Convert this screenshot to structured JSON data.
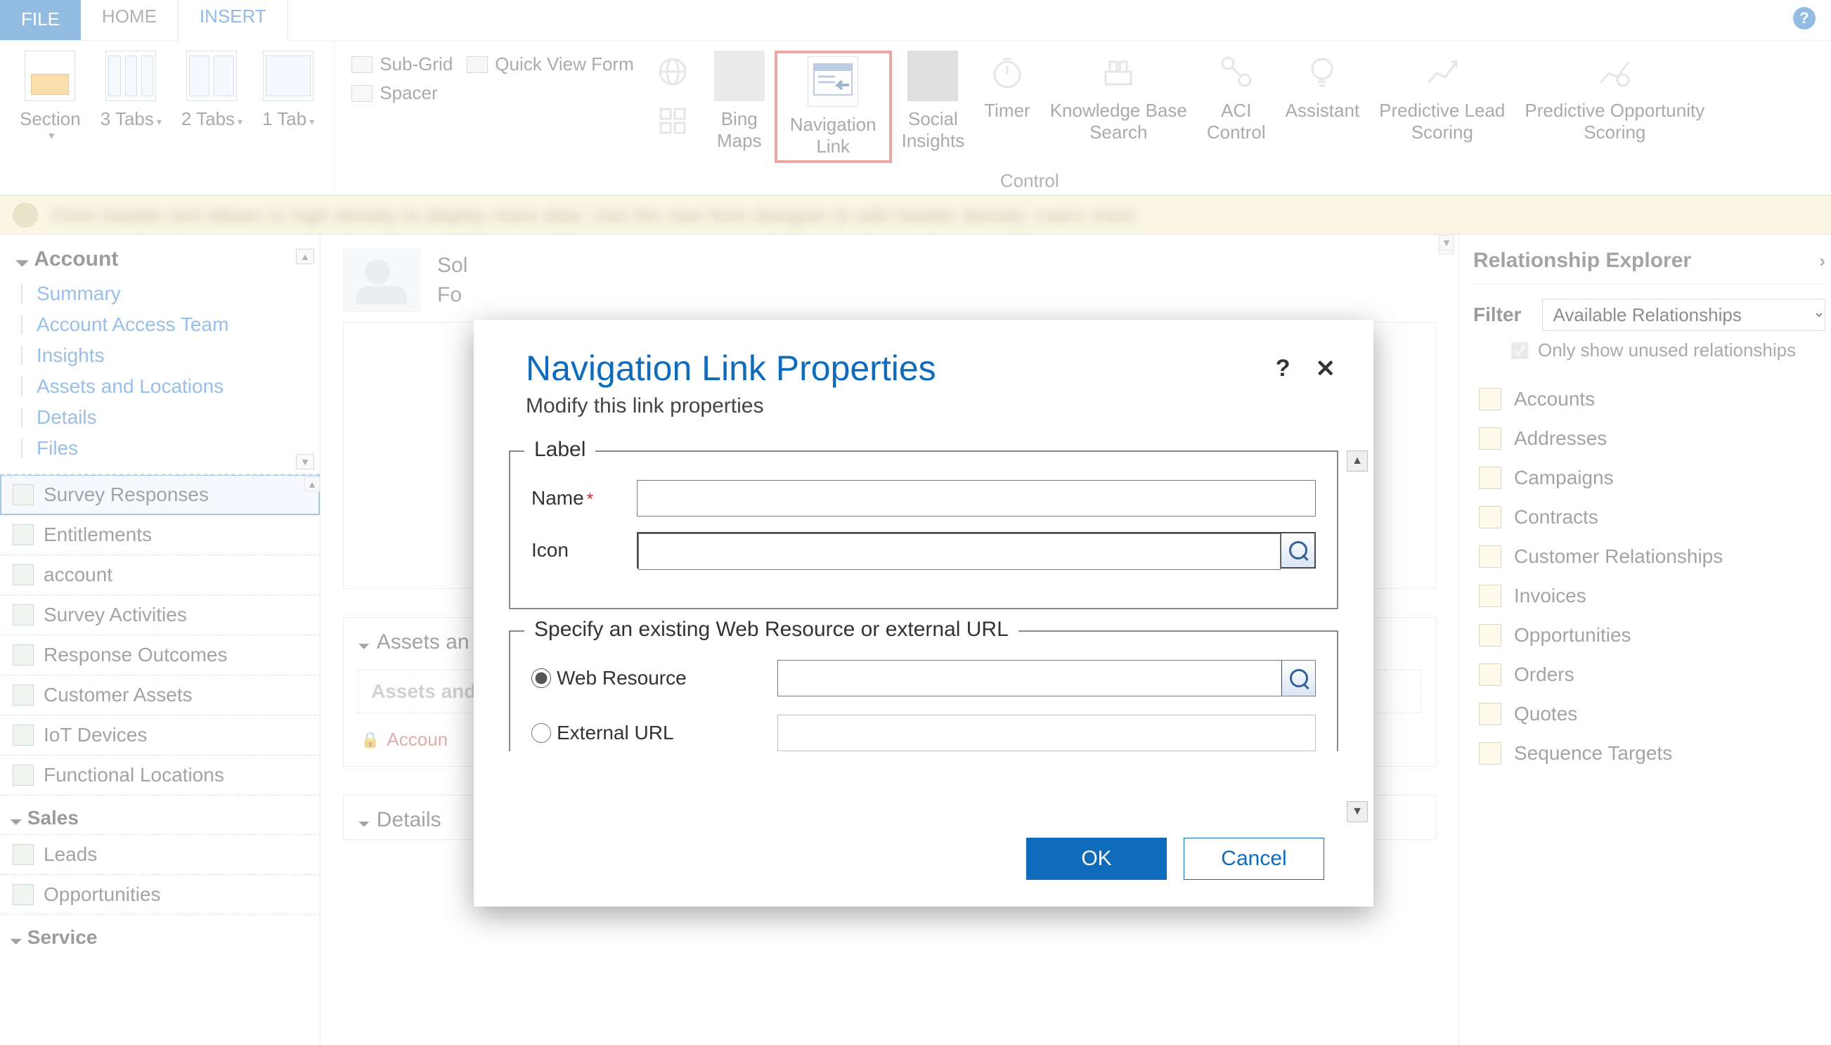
{
  "tabs": {
    "file": "FILE",
    "home": "HOME",
    "insert": "INSERT"
  },
  "ribbon": {
    "section": "Section",
    "tabs3": "3\nTabs",
    "tabs2": "2\nTabs",
    "tab1": "1\nTab",
    "subgrid": "Sub-Grid",
    "spacer": "Spacer",
    "quickview": "Quick View Form",
    "bing": "Bing\nMaps",
    "navlink": "Navigation\nLink",
    "social": "Social\nInsights",
    "timer": "Timer",
    "kb": "Knowledge Base\nSearch",
    "aci": "ACI\nControl",
    "assistant": "Assistant",
    "plead": "Predictive Lead\nScoring",
    "popp": "Predictive Opportunity\nScoring",
    "group_control": "Control"
  },
  "leftnav": {
    "header": "Account",
    "links": [
      "Summary",
      "Account Access Team",
      "Insights",
      "Assets and Locations",
      "Details",
      "Files"
    ],
    "items": [
      "Survey Responses",
      "Entitlements",
      "account",
      "Survey Activities",
      "Response Outcomes",
      "Customer Assets",
      "IoT Devices",
      "Functional Locations"
    ],
    "sales_hdr": "Sales",
    "sales_items": [
      "Leads",
      "Opportunities"
    ],
    "service_hdr": "Service"
  },
  "canvas": {
    "sol_label": "Sol",
    "form_label": "Fo",
    "assets_hdr": "Assets an",
    "assets_sub": "Assets and",
    "lock_text": "Accoun",
    "details_hdr": "Details"
  },
  "rightpanel": {
    "title": "Relationship Explorer",
    "filter_label": "Filter",
    "filter_value": "Available Relationships",
    "only_unused": "Only show unused relationships",
    "items": [
      "Accounts",
      "Addresses",
      "Campaigns",
      "Contracts",
      "Customer Relationships",
      "Invoices",
      "Opportunities",
      "Orders",
      "Quotes",
      "Sequence Targets"
    ]
  },
  "modal": {
    "title": "Navigation Link Properties",
    "subtitle": "Modify this link properties",
    "help": "?",
    "close": "✕",
    "fs_label": "Label",
    "name_lbl": "Name",
    "icon_lbl": "Icon",
    "fs_src": "Specify an existing Web Resource or external URL",
    "web_res": "Web Resource",
    "ext_url": "External URL",
    "ok": "OK",
    "cancel": "Cancel"
  }
}
